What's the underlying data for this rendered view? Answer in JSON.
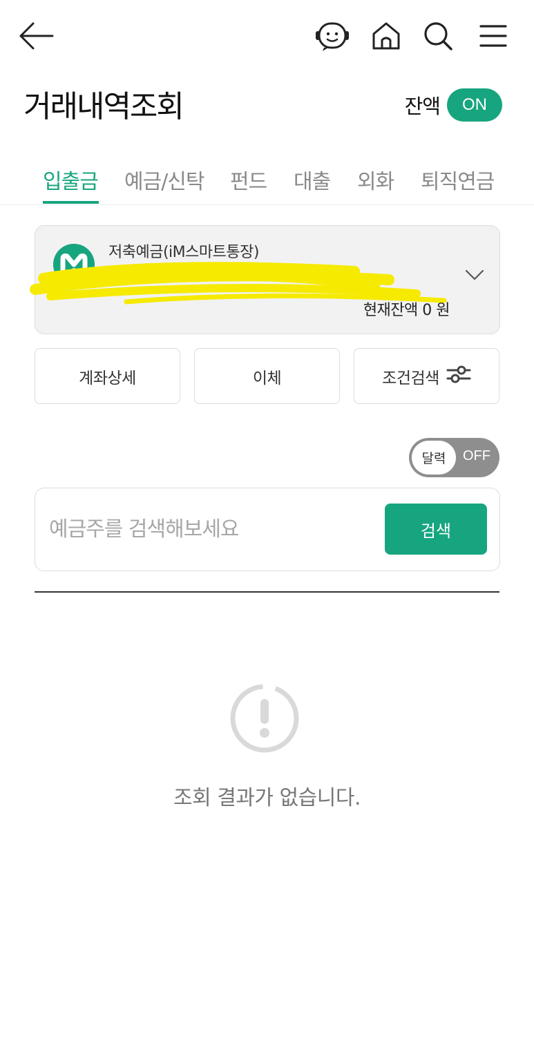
{
  "header": {
    "icons": [
      "back-arrow-icon",
      "chatbot-icon",
      "home-icon",
      "search-icon",
      "menu-icon"
    ],
    "title": "거래내역조회",
    "balance_label": "잔액",
    "balance_toggle": "ON"
  },
  "tabs": [
    {
      "label": "입출금",
      "active": true
    },
    {
      "label": "예금/신탁",
      "active": false
    },
    {
      "label": "펀드",
      "active": false
    },
    {
      "label": "대출",
      "active": false
    },
    {
      "label": "외화",
      "active": false
    },
    {
      "label": "퇴직연금",
      "active": false
    }
  ],
  "account": {
    "name": "저축예금(iM스마트통장)",
    "current_balance": "현재잔액 0 원"
  },
  "actions": {
    "detail": "계좌상세",
    "transfer": "이체",
    "filter": "조건검색"
  },
  "calendar_toggle": {
    "label": "달력",
    "state": "OFF"
  },
  "search": {
    "placeholder": "예금주를 검색해보세요",
    "value": "",
    "button": "검색"
  },
  "empty_state": {
    "icon": "alert-circle-icon",
    "message": "조회 결과가 없습니다."
  },
  "colors": {
    "accent": "#17a57f",
    "toggle_off": "#8e8e8e",
    "redaction": "#f5ea00"
  }
}
